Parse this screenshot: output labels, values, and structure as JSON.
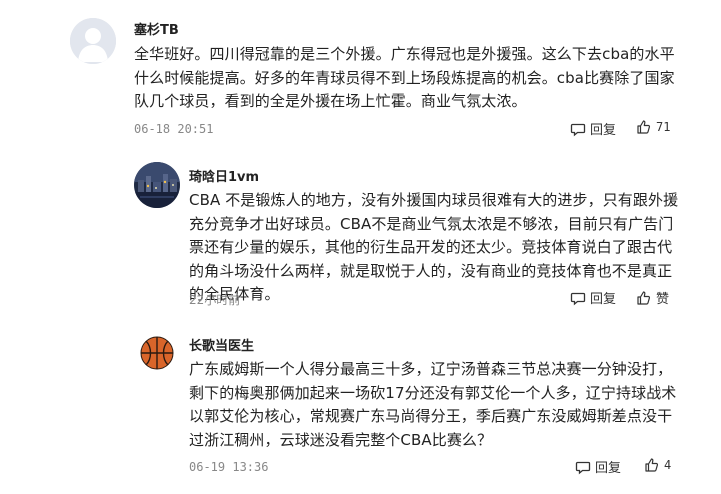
{
  "comments": [
    {
      "username": "塞杉TB",
      "content": "全华班好。四川得冠靠的是三个外援。广东得冠也是外援强。这么下去cba的水平什么时候能提高。好多的年青球员得不到上场段炼提高的机会。cba比赛除了国家队几个球员，看到的全是外援在场上忙霍。商业气氛太浓。",
      "time": "06-18 20:51",
      "reply_label": "回复",
      "like_count": "71",
      "avatar": "default-avatar"
    },
    {
      "username": "琦晗日1vm",
      "content": "CBA 不是锻炼人的地方，没有外援国内球员很难有大的进步，只有跟外援充分竞争才出好球员。CBA不是商业气氛太浓是不够浓，目前只有广告门票还有少量的娱乐，其他的衍生品开发的还太少。竞技体育说白了跟古代的角斗场没什么两样，就是取悦于人的，没有商业的竞技体育也不是真正的全民体育。",
      "time": "22小时前",
      "reply_label": "回复",
      "like_label": "赞",
      "avatar": "night-city-avatar"
    },
    {
      "username": "长歌当医生",
      "content": "广东威姆斯一个人得分最高三十多，辽宁汤普森三节总决赛一分钟没打，剩下的梅奥那俩加起来一场砍17分还没有郭艾伦一个人多，辽宁持球战术以郭艾伦为核心，常规赛广东马尚得分王，季后赛广东没威姆斯差点没干过浙江稠州，云球迷没看完整个CBA比赛么？",
      "time": "06-19 13:36",
      "reply_label": "回复",
      "like_count": "4",
      "avatar": "basketball-avatar"
    }
  ]
}
